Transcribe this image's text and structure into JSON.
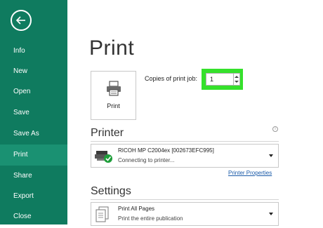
{
  "sidebar": {
    "items": [
      {
        "label": "Info"
      },
      {
        "label": "New"
      },
      {
        "label": "Open"
      },
      {
        "label": "Save"
      },
      {
        "label": "Save As"
      },
      {
        "label": "Print"
      },
      {
        "label": "Share"
      },
      {
        "label": "Export"
      },
      {
        "label": "Close"
      }
    ],
    "active": "Print"
  },
  "main": {
    "title": "Print",
    "print_button_label": "Print",
    "copies_label": "Copies of print job:",
    "copies_value": "1",
    "printer_section": {
      "title": "Printer",
      "printer_name": "RICOH MP C2004ex [002673EFC995]",
      "printer_status": "Connecting to printer...",
      "properties_link": "Printer Properties"
    },
    "settings_section": {
      "title": "Settings",
      "pages_option": "Print All Pages",
      "pages_desc": "Print the entire publication"
    }
  },
  "colors": {
    "sidebar_bg": "#0f7b5f",
    "sidebar_active": "#1a9172",
    "highlight": "#35e12b",
    "link": "#1a5aa8"
  }
}
